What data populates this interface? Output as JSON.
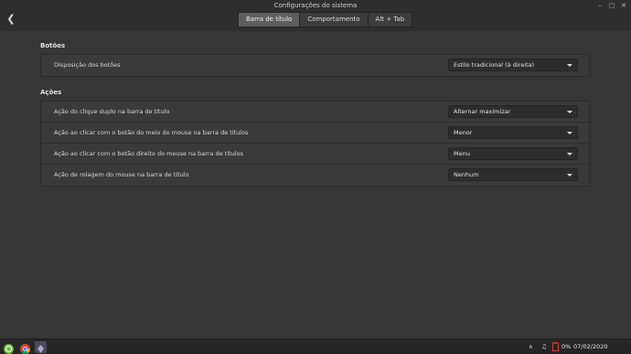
{
  "window": {
    "title": "Configurações do sistema",
    "back_icon": "back-arrow-icon",
    "controls": [
      "minimize-icon",
      "maximize-icon",
      "close-icon"
    ]
  },
  "tabs": [
    {
      "label": "Barra de título",
      "active": true
    },
    {
      "label": "Comportamento",
      "active": false
    },
    {
      "label": "Alt + Tab",
      "active": false
    }
  ],
  "sections": [
    {
      "title": "Botões",
      "rows": [
        {
          "label": "Disposição dos botões",
          "value": "Estilo tradicional (à direita)"
        }
      ]
    },
    {
      "title": "Ações",
      "rows": [
        {
          "label": "Ação do clique duplo na barra de título",
          "value": "Alternar maximizar"
        },
        {
          "label": "Ação ao clicar com o botão do meio do mouse na barra de títulos",
          "value": "Menor"
        },
        {
          "label": "Ação ao clicar com o botão direito do mouse na barra de títulos",
          "value": "Menu"
        },
        {
          "label": "Ação de rolagem do mouse na barra de título",
          "value": "Nenhum"
        }
      ]
    }
  ],
  "taskbar": {
    "launchers": [
      "menu-icon",
      "chrome-icon",
      "settings-icon"
    ],
    "tray": {
      "battery": "0%",
      "datetime": "07/02/2020 10:48:14"
    }
  },
  "colors": {
    "background": "#363636",
    "titlebar": "#2e2e2e",
    "active_tab": "#5e5e5e",
    "panel": "#3a3a3a",
    "taskbar": "#262626",
    "menu_green": "#6cbb3c",
    "battery_red": "#e03a3a"
  }
}
